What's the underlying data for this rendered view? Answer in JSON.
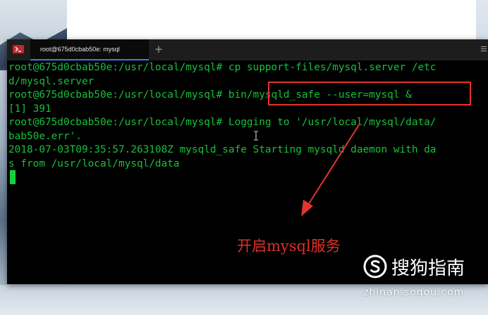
{
  "terminal": {
    "tab_title": "root@675d0cbab50e: mysql",
    "new_tab_symbol": "+",
    "lines": [
      "root@675d0cbab50e:/usr/local/mysql# cp support-files/mysql.server /etc",
      "d/mysql.server",
      "root@675d0cbab50e:/usr/local/mysql# bin/mysqld_safe --user=mysql &",
      "[1] 391",
      "root@675d0cbab50e:/usr/local/mysql# Logging to '/usr/local/mysql/data/",
      "bab50e.err'.",
      "2018-07-03T09:35:57.263108Z mysqld_safe Starting mysqld daemon with da",
      "s from /usr/local/mysql/data"
    ]
  },
  "annotation": {
    "text": "开启mysql服务",
    "color": "#e0302a"
  },
  "watermark": {
    "title": "搜狗指南",
    "url": "zhinan.sogou.com"
  },
  "colors": {
    "terminal_bg": "#000000",
    "terminal_text": "#16c13c",
    "tab_accent": "#3b7cf0",
    "annotation_red": "#e3342f"
  },
  "icons": {
    "app": "terminal-app-icon",
    "new_tab": "plus-icon",
    "mouse": "text-cursor-icon",
    "logo": "sogou-logo"
  }
}
